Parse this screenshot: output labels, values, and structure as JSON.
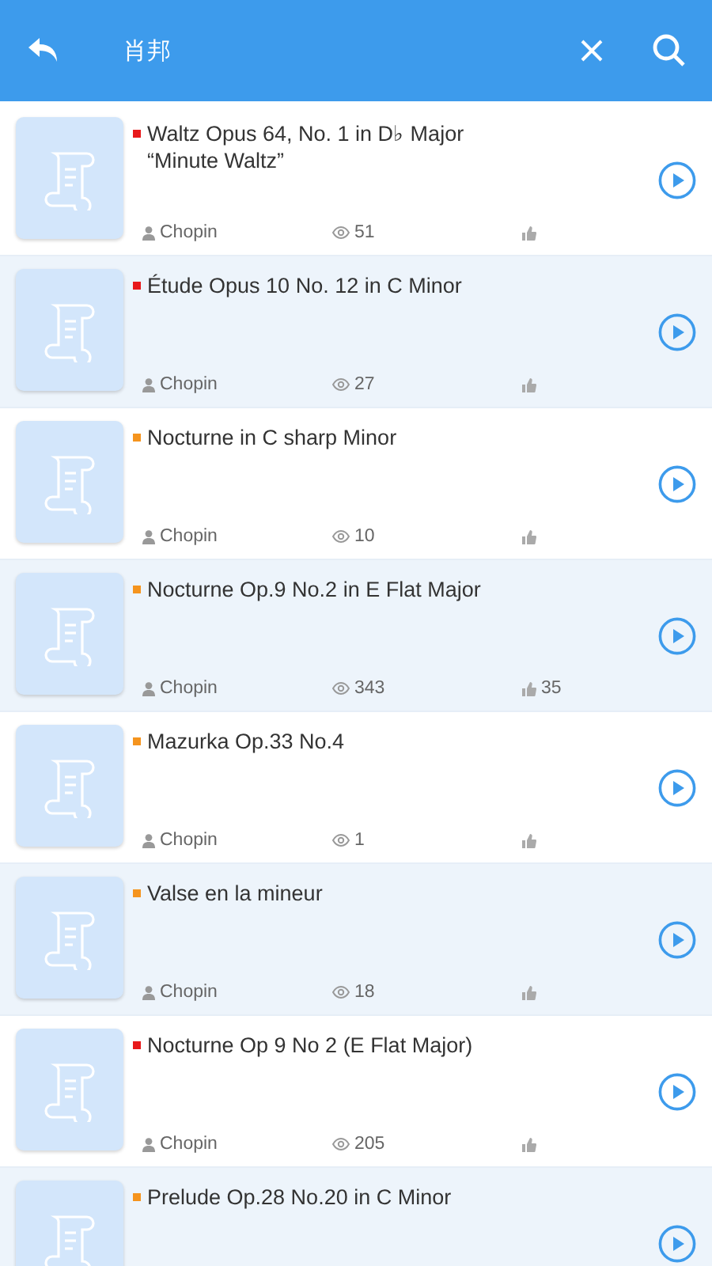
{
  "header": {
    "title": "肖邦"
  },
  "items": [
    {
      "title": "Waltz Opus 64, No. 1 in D♭ Major “Minute Waltz”",
      "color": "#e8191b",
      "author": "Chopin",
      "views": "51"
    },
    {
      "title": "Étude Opus 10 No. 12 in C Minor",
      "color": "#e8191b",
      "author": "Chopin",
      "views": "27"
    },
    {
      "title": "Nocturne in C sharp Minor",
      "color": "#f5941e",
      "author": "Chopin",
      "views": "10"
    },
    {
      "title": "Nocturne Op.9 No.2 in E Flat Major",
      "color": "#f5941e",
      "author": "Chopin",
      "views": "343",
      "likes": "35"
    },
    {
      "title": "Mazurka Op.33 No.4",
      "color": "#f5941e",
      "author": "Chopin",
      "views": "1"
    },
    {
      "title": "Valse en la mineur",
      "color": "#f5941e",
      "author": "Chopin",
      "views": "18"
    },
    {
      "title": "Nocturne Op 9 No 2 (E Flat Major)",
      "color": "#e8191b",
      "author": "Chopin",
      "views": "205"
    },
    {
      "title": "Prelude Op.28 No.20 in C Minor",
      "color": "#f5941e"
    }
  ]
}
